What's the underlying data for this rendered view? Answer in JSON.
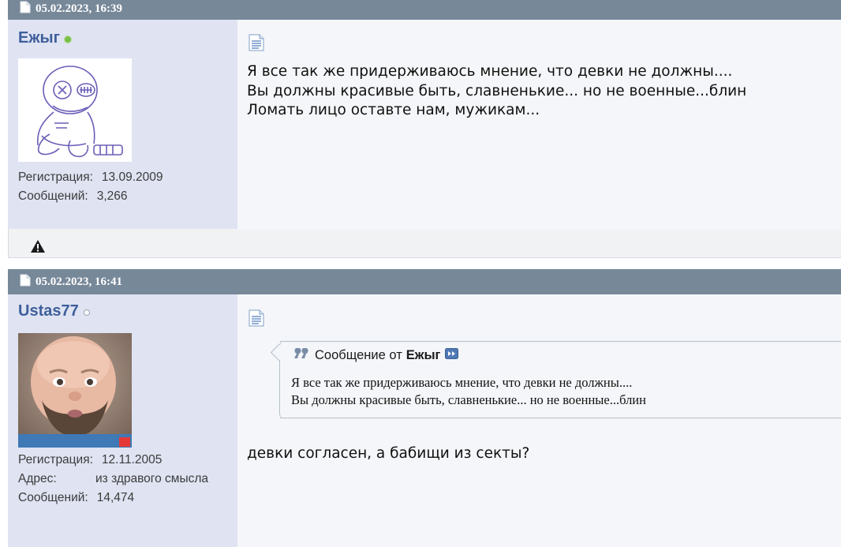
{
  "posts": [
    {
      "date": "05.02.2023, 16:39",
      "username": "Ежыг",
      "status": "online",
      "registration_label": "Регистрация:",
      "registration_value": "13.09.2009",
      "posts_label": "Сообщений:",
      "posts_value": "3,266",
      "message_lines": [
        "Я все так же придерживаюсь мнение, что девки не должны....",
        "Вы должны красивые быть, славненькие... но не военные...блин",
        "Ломать лицо оставте нам, мужикам..."
      ]
    },
    {
      "date": "05.02.2023, 16:41",
      "username": "Ustas77",
      "status": "offline",
      "registration_label": "Регистрация:",
      "registration_value": "12.11.2005",
      "address_label": "Адрес:",
      "address_value": "из здравого смысла",
      "posts_label": "Сообщений:",
      "posts_value": "14,474",
      "quote": {
        "prefix": "Сообщение от",
        "author": "Ежыг",
        "lines": [
          "Я все так же придерживаюсь мнение, что девки не должны....",
          "Вы должны красивые быть, славненькие... но не военные...блин"
        ]
      },
      "message_lines": [
        "девки согласен, а бабищи из секты?"
      ]
    }
  ],
  "colors": {
    "header_bg": "#778899",
    "userinfo_bg": "#dfe3f2",
    "content_bg": "#f5f6f9",
    "username": "#3e5f9b"
  },
  "icons": [
    "document-icon",
    "online-status-icon",
    "offline-status-icon",
    "report-warning-icon",
    "quote-icon",
    "view-post-icon"
  ]
}
